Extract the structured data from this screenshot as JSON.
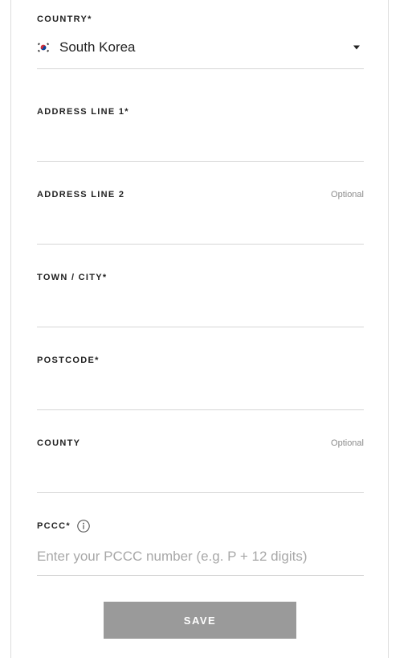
{
  "form": {
    "country": {
      "label": "COUNTRY*",
      "value": "South Korea",
      "flag_icon": "south-korea-flag-icon",
      "dropdown_icon": "caret-down-icon"
    },
    "address_line_1": {
      "label": "ADDRESS LINE 1*",
      "value": ""
    },
    "address_line_2": {
      "label": "ADDRESS LINE 2",
      "optional_label": "Optional",
      "value": ""
    },
    "town_city": {
      "label": "TOWN / CITY*",
      "value": ""
    },
    "postcode": {
      "label": "POSTCODE*",
      "value": ""
    },
    "county": {
      "label": "COUNTY",
      "optional_label": "Optional",
      "value": ""
    },
    "pccc": {
      "label": "PCCC*",
      "placeholder": "Enter your PCCC number (e.g. P + 12 digits)",
      "value": "",
      "info_icon": "info-icon"
    },
    "save_label": "SAVE"
  },
  "colors": {
    "button_background": "#9a9a9a",
    "button_text": "#ffffff",
    "divider": "#d6d6d6",
    "placeholder": "#a8a8a8",
    "optional_text": "#8c8c8c"
  }
}
